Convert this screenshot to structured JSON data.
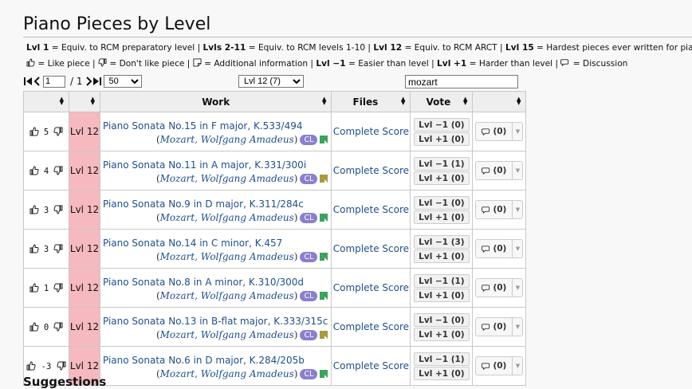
{
  "page": {
    "title": "Piano Pieces by Level",
    "suggestions_title": "Suggestions"
  },
  "legend": {
    "line1": [
      {
        "key": "Lvl 1",
        "desc": " = Equiv. to RCM preparatory level"
      },
      {
        "key": "Lvls 2-11",
        "desc": " = Equiv. to RCM levels 1-10"
      },
      {
        "key": "Lvl 12",
        "desc": " = Equiv. to RCM ARCT"
      },
      {
        "key": "Lvl 15",
        "desc": " = Hardest pieces ever written for piano"
      }
    ],
    "like": " = Like piece",
    "dislike": " = Don't like piece",
    "info": " = Additional information",
    "easier_key": "Lvl −1",
    "easier": " = Easier than level",
    "harder_key": "Lvl +1",
    "harder": " = Harder than level",
    "discussion": " = Discussion"
  },
  "pager": {
    "page_value": "1",
    "page_total": "/ 1",
    "per_page": "50",
    "level_filter": "Lvl 12 (7)",
    "search_value": "mozart"
  },
  "table": {
    "headers": {
      "likes": "",
      "level": "",
      "work": "Work",
      "files": "Files",
      "vote": "Vote",
      "discuss": ""
    },
    "rows": [
      {
        "likes": "5",
        "level": "Lvl 12",
        "work": "Piano Sonata No.15 in F major, K.533/494",
        "composer": "Mozart, Wolfgang Amadeus",
        "cl": "CL",
        "note_color": "#3aa35c",
        "files": "Complete Score",
        "down": "Lvl −1 (0)",
        "up": "Lvl +1 (0)",
        "disc": "(0)"
      },
      {
        "likes": "4",
        "level": "Lvl 12",
        "work": "Piano Sonata No.11 in A major, K.331/300i",
        "composer": "Mozart, Wolfgang Amadeus",
        "cl": "CL",
        "note_color": "#a99a3a",
        "files": "Complete Score",
        "down": "Lvl −1 (1)",
        "up": "Lvl +1 (0)",
        "disc": "(0)"
      },
      {
        "likes": "3",
        "level": "Lvl 12",
        "work": "Piano Sonata No.9 in D major, K.311/284c",
        "composer": "Mozart, Wolfgang Amadeus",
        "cl": "CL",
        "note_color": "#3aa35c",
        "files": "Complete Score",
        "down": "Lvl −1 (0)",
        "up": "Lvl +1 (0)",
        "disc": "(0)"
      },
      {
        "likes": "3",
        "level": "Lvl 12",
        "work": "Piano Sonata No.14 in C minor, K.457",
        "composer": "Mozart, Wolfgang Amadeus",
        "cl": "CL",
        "note_color": "#3aa35c",
        "files": "Complete Score",
        "down": "Lvl −1 (3)",
        "up": "Lvl +1 (0)",
        "disc": "(0)"
      },
      {
        "likes": "1",
        "level": "Lvl 12",
        "work": "Piano Sonata No.8 in A minor, K.310/300d",
        "composer": "Mozart, Wolfgang Amadeus",
        "cl": "CL",
        "note_color": "#3aa35c",
        "files": "Complete Score",
        "down": "Lvl −1 (1)",
        "up": "Lvl +1 (0)",
        "disc": "(0)"
      },
      {
        "likes": "0",
        "level": "Lvl 12",
        "work": "Piano Sonata No.13 in B-flat major, K.333/315c",
        "composer": "Mozart, Wolfgang Amadeus",
        "cl": "CL",
        "note_color": "#a99a3a",
        "files": "Complete Score",
        "down": "Lvl −1 (0)",
        "up": "Lvl +1 (0)",
        "disc": "(0)"
      },
      {
        "likes": "-3",
        "level": "Lvl 12",
        "work": "Piano Sonata No.6 in D major, K.284/205b",
        "composer": "Mozart, Wolfgang Amadeus",
        "cl": "CL",
        "note_color": "#3aa35c",
        "files": "Complete Score",
        "down": "Lvl −1 (1)",
        "up": "Lvl +1 (0)",
        "disc": "(0)"
      }
    ]
  }
}
